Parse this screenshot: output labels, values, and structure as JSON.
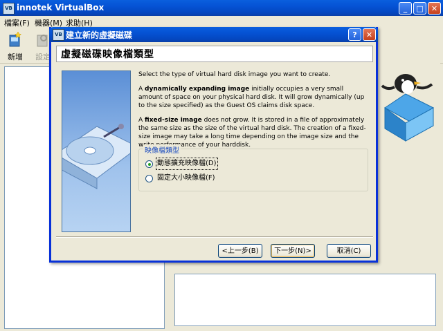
{
  "main_window": {
    "title": "innotek VirtualBox",
    "icon": "vbox-app-icon",
    "controls": {
      "minimize": "_",
      "maximize": "□",
      "close": "✕"
    }
  },
  "menu": {
    "items": [
      "檔案(F)",
      "機器(M)",
      "求助(H)"
    ]
  },
  "toolbar": {
    "new_label": "新增",
    "settings_label": "設定"
  },
  "dialog": {
    "title": "建立新的虛擬磁碟",
    "help": "?",
    "close": "✕",
    "heading": "虛擬磁碟映像檔類型",
    "intro": "Select the type of virtual hard disk image you want to create.",
    "para1_pre": "A ",
    "para1_bold": "dynamically expanding image",
    "para1_post": " initially occupies a very small amount of space on your physical hard disk. It will grow dynamically (up to the size specified) as the Guest OS claims disk space.",
    "para2_pre": "A ",
    "para2_bold": "fixed-size image",
    "para2_post": " does not grow. It is stored in a file of approximately the same size as the size of the virtual hard disk. The creation of a fixed-size image may take a long time depending on the image size and the write performance of your harddisk.",
    "group_title": "映像檔類型",
    "options": [
      {
        "label": "動態擴充映像檔(D)",
        "selected": true
      },
      {
        "label": "固定大小映像檔(F)",
        "selected": false
      }
    ],
    "buttons": {
      "back": "<上一步(B)",
      "next": "下一步(N)>",
      "cancel": "取消(C)"
    }
  },
  "colors": {
    "titlebar": "#0552d4",
    "face": "#ece9d8",
    "group_title": "#1a4bbf"
  }
}
